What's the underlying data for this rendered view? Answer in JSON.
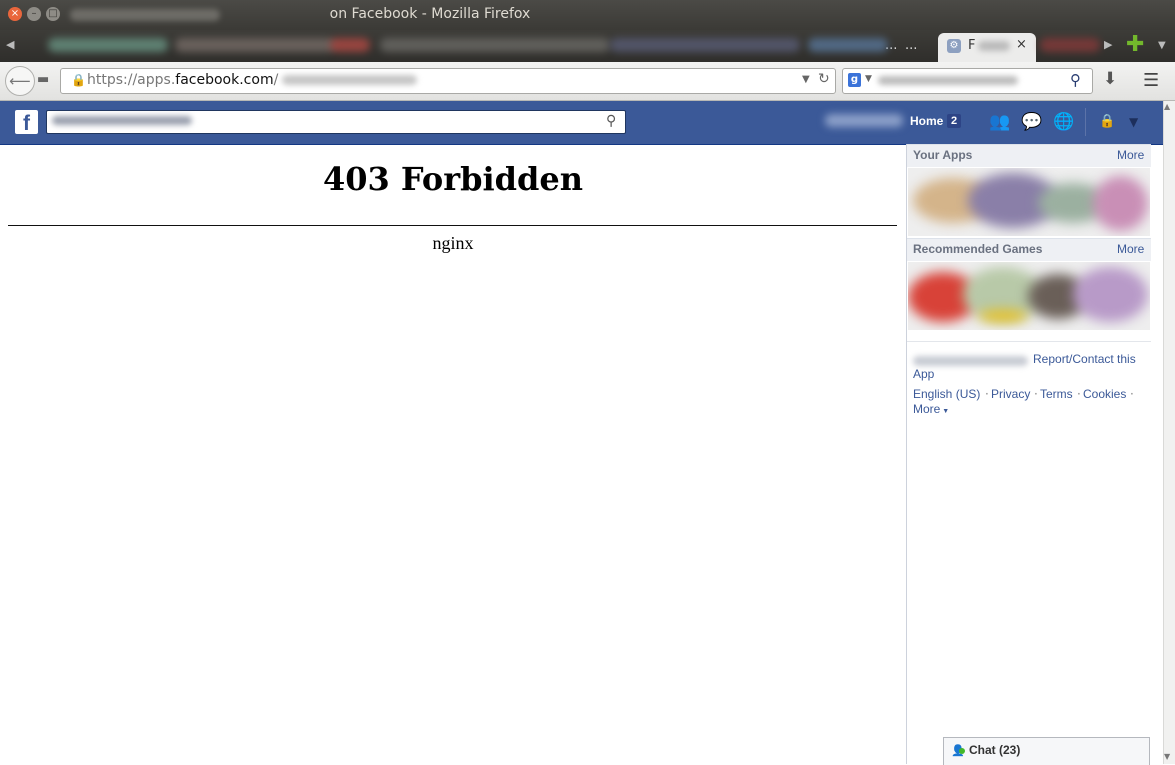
{
  "window": {
    "title": "on Facebook - Mozilla Firefox",
    "close_glyph": "×",
    "minimize_glyph": "–",
    "maximize_glyph": "□"
  },
  "tabs": {
    "active_title": "F",
    "close_glyph": "×",
    "ellipsis_1": "...",
    "ellipsis_2": "...",
    "new_tab_glyph": "✚"
  },
  "navbar": {
    "url_prefix": "https://apps.",
    "url_domain": "facebook.com",
    "url_path": "/"
  },
  "facebook": {
    "logo": "f",
    "home_label": "Home",
    "home_count": "2"
  },
  "content": {
    "heading": "403 Forbidden",
    "server": "nginx"
  },
  "sidebar": {
    "your_apps_title": "Your Apps",
    "your_apps_more": "More",
    "recommended_title": "Recommended Games",
    "recommended_more": "More",
    "report_link_1": "Report/Contact this",
    "report_link_2": "App",
    "footer": {
      "english": "English (US)",
      "privacy": "Privacy",
      "terms": "Terms",
      "cookies": "Cookies",
      "more": "More"
    }
  },
  "chat": {
    "label": "Chat (23)"
  },
  "colors": {
    "facebook_blue": "#3b5998",
    "link": "#3b5998",
    "online": "#42b72a"
  }
}
